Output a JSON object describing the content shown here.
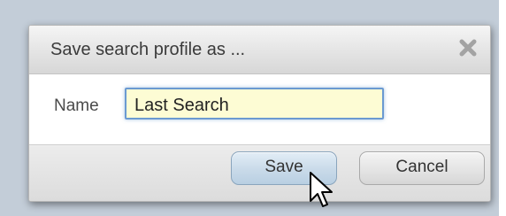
{
  "dialog": {
    "title": "Save search profile as ...",
    "close_icon": "close-x-icon",
    "name_label": "Name",
    "name_value": "Last Search",
    "save_label": "Save",
    "cancel_label": "Cancel"
  },
  "cursor": {
    "icon": "arrow-pointer-icon"
  },
  "colors": {
    "backdrop": "#c3cdd8",
    "input_focus_border": "#6b9ad1",
    "input_background": "#fdfcd4",
    "save_button_fill": "#c9dae9"
  }
}
